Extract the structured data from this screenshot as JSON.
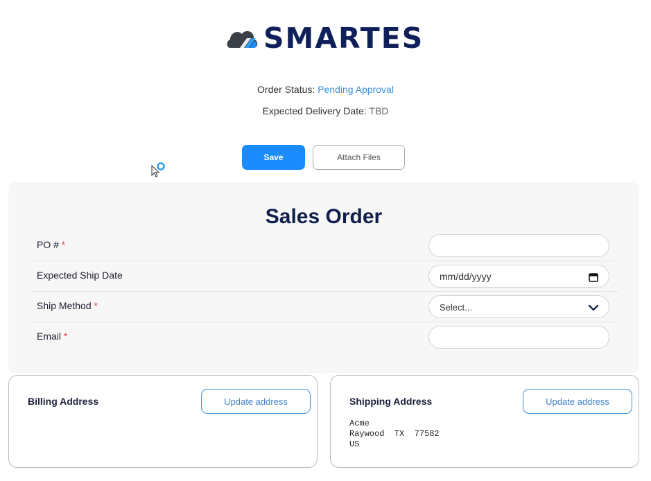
{
  "brand": {
    "name": "SMARTES"
  },
  "order": {
    "status_label": "Order Status:",
    "status_value": "Pending Approval",
    "delivery_label": "Expected Delivery Date:",
    "delivery_value": "TBD"
  },
  "actions": {
    "save_label": "Save",
    "attach_label": "Attach Files"
  },
  "form": {
    "title": "Sales Order",
    "required_marker": "*",
    "fields": [
      {
        "label": "PO #",
        "value": ""
      },
      {
        "label": "Expected Ship Date",
        "value": "mm/dd/yyyy"
      },
      {
        "label": "Ship Method",
        "value": "Select..."
      },
      {
        "label": "Email",
        "value": ""
      }
    ]
  },
  "billing": {
    "title": "Billing Address",
    "button_label": "Update address"
  },
  "shipping": {
    "title": "Shipping Address",
    "button_label": "Update address",
    "lines": [
      "Acme",
      "Raywood  TX  77582",
      "US"
    ]
  },
  "colors": {
    "accent": "#1a8cff",
    "brand_dark": "#0f1f5a",
    "status_blue": "#3b8fd8",
    "required": "#e04545"
  }
}
